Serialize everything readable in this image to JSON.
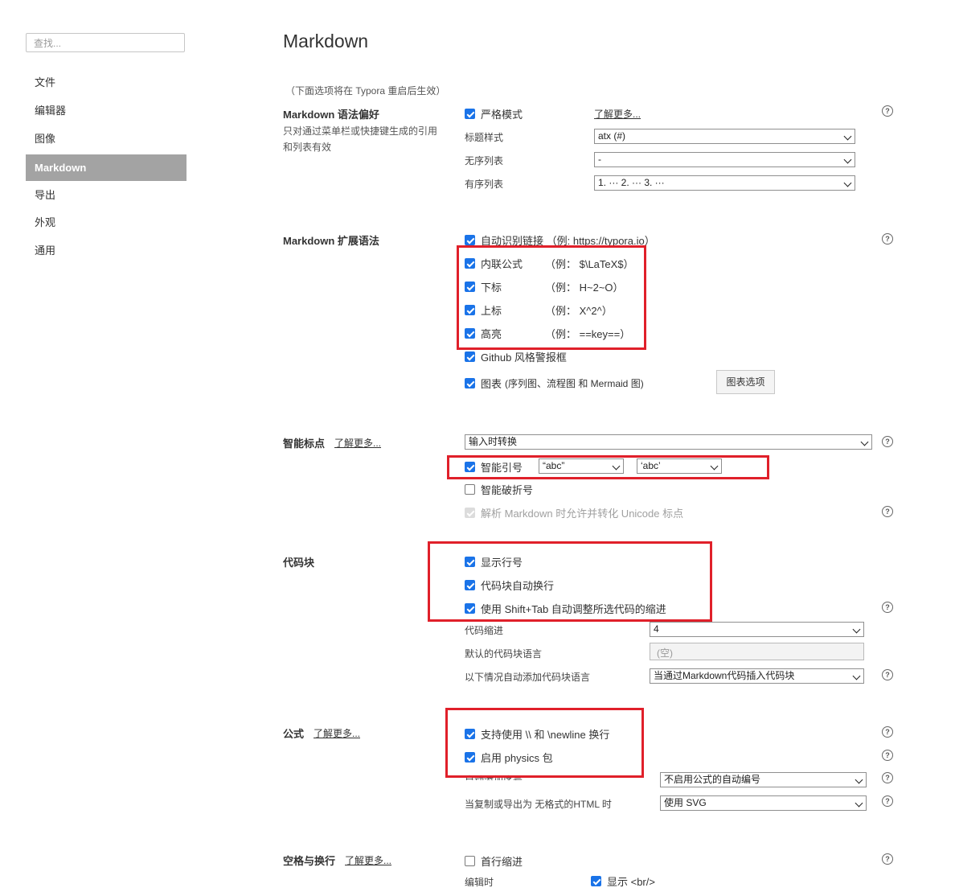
{
  "sidebar": {
    "search_placeholder": "查找...",
    "items": [
      {
        "label": "文件"
      },
      {
        "label": "编辑器"
      },
      {
        "label": "图像"
      },
      {
        "label": "Markdown",
        "active": true
      },
      {
        "label": "导出"
      },
      {
        "label": "外观"
      },
      {
        "label": "通用"
      }
    ]
  },
  "page_title": "Markdown",
  "restart_note": "（下面选项将在 Typora 重启后生效）",
  "help_glyph": "?",
  "learn_more": "了解更多...",
  "syntax_pref": {
    "title": "Markdown 语法偏好",
    "desc": "只对通过菜单栏或快捷键生成的引用和列表有效",
    "strict_mode": "严格模式",
    "heading_style_label": "标题样式",
    "heading_style_value": "atx (#)",
    "unordered_label": "无序列表",
    "unordered_value": "-",
    "ordered_label": "有序列表",
    "ordered_value": "1. ··· 2. ··· 3. ···"
  },
  "extended": {
    "title": "Markdown 扩展语法",
    "autolink": "自动识别链接 （例: https://typora.io）",
    "inline_math": "内联公式",
    "inline_math_ex": "（例： $\\LaTeX$）",
    "subscript": "下标",
    "subscript_ex": "（例： H~2~O）",
    "superscript": "上标",
    "superscript_ex": "（例： X^2^）",
    "highlight": "高亮",
    "highlight_ex": "（例： ==key==）",
    "github_alerts": "Github 风格警报框",
    "diagrams": "图表",
    "diagrams_note": "(序列图、流程图 和 Mermaid 图)",
    "diagram_options_button": "图表选项"
  },
  "smart_punct": {
    "title": "智能标点",
    "mode_value": "输入时转换",
    "smart_quotes": "智能引号",
    "double_quote_value": "“abc”",
    "single_quote_value": "‘abc’",
    "smart_dash": "智能破折号",
    "unicode_punct": "解析 Markdown 时允许并转化 Unicode 标点"
  },
  "code_block": {
    "title": "代码块",
    "line_numbers": "显示行号",
    "wrap": "代码块自动换行",
    "shift_tab": "使用 Shift+Tab 自动调整所选代码的缩进",
    "indent_label": "代码缩进",
    "indent_value": "4",
    "default_lang_label": "默认的代码块语言",
    "default_lang_placeholder": "(空)",
    "auto_lang_label": "以下情况自动添加代码块语言",
    "auto_lang_value": "当通过Markdown代码插入代码块"
  },
  "math": {
    "title": "公式",
    "newline": "支持使用 \\\\ 和 \\newline 换行",
    "physics": "启用 physics 包",
    "auto_number_label": "自动添加序号",
    "auto_number_value": "不启用公式的自动编号",
    "copy_export_label": "当复制或导出为 无格式的HTML 时",
    "copy_export_value": "使用 SVG"
  },
  "whitespace": {
    "title": "空格与换行",
    "first_line_indent": "首行缩进",
    "editing_label": "编辑时",
    "show_br": "显示 <br/>"
  },
  "colors": {
    "accent": "#1a73e8",
    "highlight_box": "#e0202a",
    "sidebar_active_bg": "#a3a3a3"
  }
}
